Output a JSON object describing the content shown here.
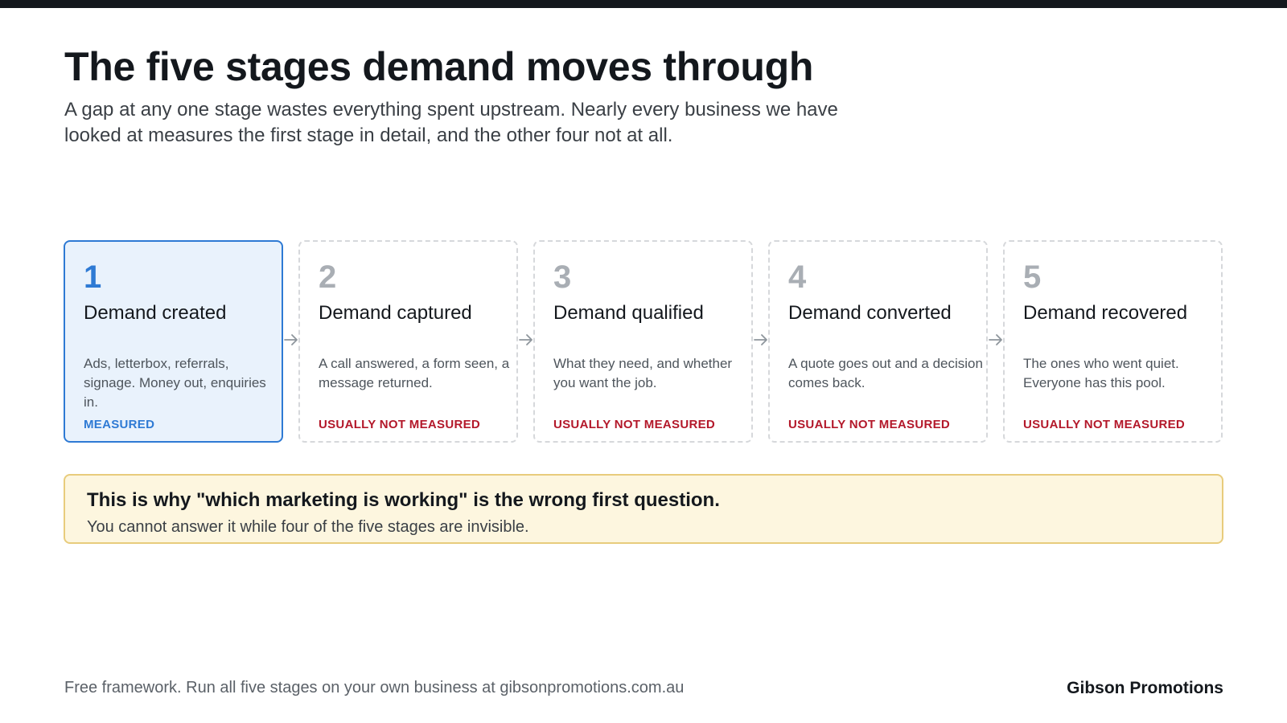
{
  "header": {
    "title": "The five stages demand moves through",
    "subtitle": "A gap at any one stage wastes everything spent upstream. Nearly every business we have looked at measures the first stage in detail, and the other four not at all."
  },
  "stages": [
    {
      "number": "1",
      "title": "Demand created",
      "description": "Ads, letterbox, referrals, signage. Money out, enquiries in.",
      "status": "MEASURED"
    },
    {
      "number": "2",
      "title": "Demand captured",
      "description": "A call answered, a form seen, a message returned.",
      "status": "USUALLY NOT MEASURED"
    },
    {
      "number": "3",
      "title": "Demand qualified",
      "description": "What they need, and whether you want the job.",
      "status": "USUALLY NOT MEASURED"
    },
    {
      "number": "4",
      "title": "Demand converted",
      "description": "A quote goes out and a decision comes back.",
      "status": "USUALLY NOT MEASURED"
    },
    {
      "number": "5",
      "title": "Demand recovered",
      "description": "The ones who went quiet. Everyone has this pool.",
      "status": "USUALLY NOT MEASURED"
    }
  ],
  "callout": {
    "headline": "This is why \"which marketing is working\" is the wrong first question.",
    "body": "You cannot answer it while four of the five stages are invisible."
  },
  "footer": {
    "note": "Free framework. Run all five stages on your own business at gibsonpromotions.com.au",
    "brand": "Gibson Promotions"
  },
  "colors": {
    "accent": "#2e7ad4",
    "warning": "#b3182a",
    "callout_background": "#fdf6df",
    "callout_border": "#e8cc7c"
  },
  "icons": {
    "connector": "arrow-right-icon"
  }
}
